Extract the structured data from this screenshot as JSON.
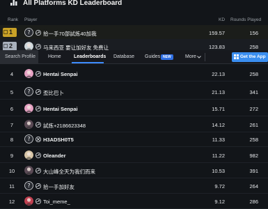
{
  "title": "All Platforms KD Leaderboard",
  "headers": {
    "rank": "Rank",
    "player": "Player",
    "kd": "KD",
    "played": "Rounds Played"
  },
  "nav": {
    "search": "Search Profile",
    "items": [
      "Home",
      "Leaderboards",
      "Database",
      "Guides",
      "More"
    ],
    "new_badge": "NEW",
    "app_button": "Get the App"
  },
  "rows": [
    {
      "rank": "1",
      "name": "拾一手70部試炼40加我",
      "kd": "159.57",
      "played": "156",
      "platform": "steam",
      "avatar": "question"
    },
    {
      "rank": "2",
      "name": "马来西亚 要让加好友 免费让",
      "kd": "123.83",
      "played": "258",
      "platform": "steam",
      "avatar": "anime"
    },
    {
      "rank": "4",
      "name": "Hentai Senpai",
      "kd": "22.13",
      "played": "258",
      "platform": "steam",
      "avatar": "anime-pink"
    },
    {
      "rank": "5",
      "name": "歪比巴卜",
      "kd": "21.13",
      "played": "341",
      "platform": "steam",
      "avatar": "question"
    },
    {
      "rank": "6",
      "name": "Hentai Senpai",
      "kd": "15.71",
      "played": "272",
      "platform": "steam",
      "avatar": "anime-pink"
    },
    {
      "rank": "7",
      "name": "試炼+2186623348",
      "kd": "14.12",
      "played": "261",
      "platform": "steam",
      "avatar": "anime-dark"
    },
    {
      "rank": "8",
      "name": "H3ADSH0T5",
      "kd": "11.33",
      "played": "258",
      "platform": "xbox",
      "avatar": "question"
    },
    {
      "rank": "9",
      "name": "Oleander",
      "kd": "11.22",
      "played": "982",
      "platform": "steam",
      "avatar": "flower"
    },
    {
      "rank": "10",
      "name": "大山峰全天为我们而来",
      "kd": "10.53",
      "played": "391",
      "platform": "steam",
      "avatar": "anime-dark"
    },
    {
      "rank": "11",
      "name": "拾一手加好友",
      "kd": "9.72",
      "played": "264",
      "platform": "steam",
      "avatar": "question"
    },
    {
      "rank": "12",
      "name": "Toi_meme_",
      "kd": "9.12",
      "played": "286",
      "platform": "steam",
      "avatar": "anime-red"
    }
  ],
  "colors": {
    "gold": "#c9a227",
    "silver": "#aab2bd",
    "accent": "#3d8bfd"
  }
}
